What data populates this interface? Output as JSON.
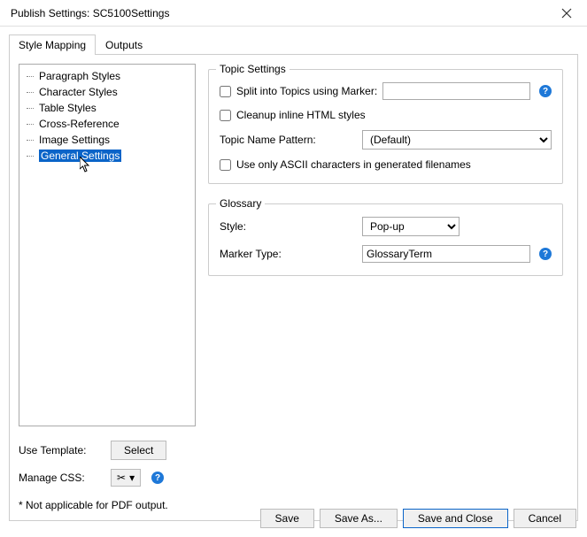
{
  "window": {
    "title": "Publish Settings: SC5100Settings"
  },
  "tabs": {
    "style_mapping": "Style Mapping",
    "outputs": "Outputs"
  },
  "tree": {
    "items": [
      "Paragraph Styles",
      "Character Styles",
      "Table Styles",
      "Cross-Reference",
      "Image Settings",
      "General Settings"
    ],
    "selected_index": 5
  },
  "sidebar": {
    "use_template_label": "Use Template:",
    "select_button": "Select",
    "manage_css_label": "Manage CSS:",
    "footnote": "* Not applicable for PDF output."
  },
  "topic_settings": {
    "group_title": "Topic Settings",
    "split_label": "Split into Topics using Marker:",
    "split_value": "",
    "cleanup_label": "Cleanup inline HTML styles",
    "name_pattern_label": "Topic Name Pattern:",
    "name_pattern_value": "(Default)",
    "ascii_label": "Use only ASCII characters in generated filenames"
  },
  "glossary": {
    "group_title": "Glossary",
    "style_label": "Style:",
    "style_value": "Pop-up",
    "marker_type_label": "Marker Type:",
    "marker_type_value": "GlossaryTerm"
  },
  "buttons": {
    "save": "Save",
    "save_as": "Save As...",
    "save_and_close": "Save and Close",
    "cancel": "Cancel"
  }
}
